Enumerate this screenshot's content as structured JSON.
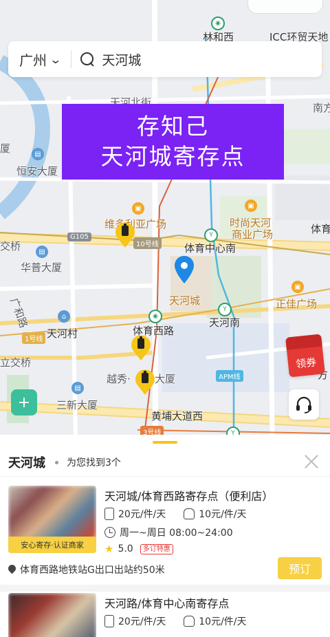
{
  "search": {
    "city": "广州",
    "query": "天河城"
  },
  "banner": {
    "line1": "存知己",
    "line2": "天河城寄存点"
  },
  "map": {
    "labels": {
      "linhexi": "林和西",
      "icc": "ICC环贸天地",
      "tianhebeijie": "天河北街",
      "nanfang": "南方",
      "hengan": "恒安大厦",
      "weiduoliya": "维多利亚广场",
      "shishang": "时尚天河",
      "shangyejie": "商业广场",
      "tiyu_right": "体育",
      "jiaoqiao": "交桥",
      "line10": "10号线",
      "g105": "G105",
      "tiyuzhongxinnan": "体育中心南",
      "huapu": "华普大厦",
      "tianhecheng": "天河城",
      "zhengjia": "正佳广场",
      "guanghe": "广和路",
      "tianhecun": "天河村",
      "tiyuxilu": "体育西路",
      "tianhenan": "天河南",
      "line1": "1号线",
      "lijiaoqiao": "立交桥",
      "yuexiu": "越秀·",
      "dasha": "大厦",
      "apm": "APM线",
      "sanxin": "三新大厦",
      "fang": "方",
      "huangpu": "黄埔大道西",
      "line3": "3号线",
      "xia": "厦"
    },
    "coupon_label": "领券"
  },
  "results": {
    "title": "天河城",
    "found_text": "为您找到3个",
    "items": [
      {
        "name": "天河城/体育西路寄存点（便利店）",
        "price_small": "20元/件/天",
        "price_large": "10元/件/天",
        "hours": "周一~周日 08:00~24:00",
        "rating": "5.0",
        "tag": "多订特惠",
        "badge": "安心寄存·认证商家",
        "address": "体育西路地铁站G出口出站约50米",
        "button": "预订"
      },
      {
        "name": "天河路/体育中心南寄存点",
        "price_small": "20元/件/天",
        "price_large": "10元/件/天"
      }
    ]
  },
  "colors": {
    "banner": "#7b22f5",
    "accent_yellow": "#f7d043",
    "pin_blue": "#1e88e5",
    "shield_green": "#3cbf9c",
    "coupon_red": "#e53935"
  },
  "icons": [
    "search-icon",
    "chevron-down-icon",
    "close-icon",
    "location-pin-icon",
    "luggage-icon",
    "bag-icon",
    "clock-icon",
    "star-icon",
    "headset-icon",
    "shield-plus-icon",
    "coupon-icon"
  ]
}
